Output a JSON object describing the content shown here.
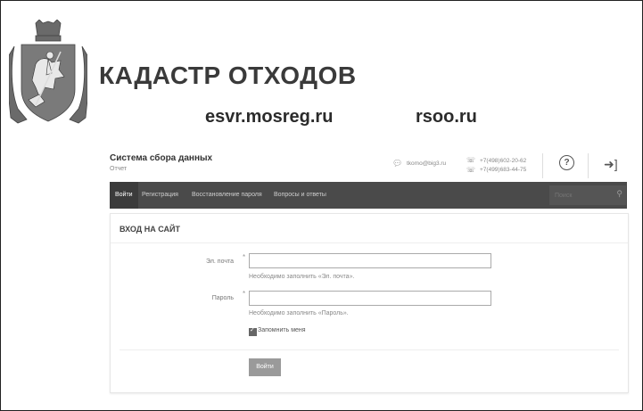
{
  "header": {
    "title": "КАДАСТР ОТХОДОВ",
    "link_left": "esvr.mosreg.ru",
    "link_right": "rsoo.ru"
  },
  "app": {
    "title": "Система сбора данных",
    "subtitle": "Отчет",
    "email": "tkomo@big3.ru",
    "phone1": "+7(498)602-20-62",
    "phone2": "+7(499)683-44-75",
    "help_glyph": "?",
    "login_glyph": "➜]"
  },
  "nav": {
    "items": [
      {
        "label": "Войти"
      },
      {
        "label": "Регистрация"
      },
      {
        "label": "Восстановление пароля"
      },
      {
        "label": "Вопросы и ответы"
      }
    ],
    "search_placeholder": "Поиск"
  },
  "login": {
    "heading": "ВХОД НА САЙТ",
    "email_label": "Эл. почта",
    "email_hint": "Необходимо заполнить «Эл. почта».",
    "password_label": "Пароль",
    "password_hint": "Необходимо заполнить «Пароль».",
    "required_mark": "*",
    "remember_label": "Запомнить меня",
    "remember_checked": true,
    "submit_label": "Войти"
  }
}
